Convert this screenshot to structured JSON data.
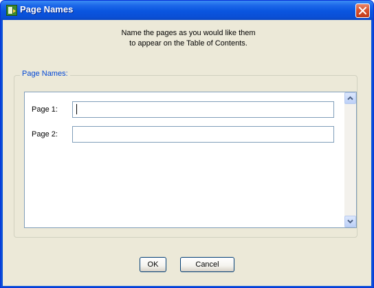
{
  "window": {
    "title": "Page Names",
    "icon": "page-names-app-icon",
    "close_icon": "close-icon"
  },
  "instructions": {
    "line1": "Name the pages as you would like them",
    "line2": "to appear on the Table of Contents."
  },
  "group": {
    "legend": "Page Names:"
  },
  "pages": [
    {
      "label": "Page 1:",
      "value": "",
      "focused": true
    },
    {
      "label": "Page 2:",
      "value": "",
      "focused": false
    }
  ],
  "scrollbar": {
    "up_icon": "chevron-up-icon",
    "down_icon": "chevron-down-icon"
  },
  "buttons": {
    "ok_label": "OK",
    "cancel_label": "Cancel"
  },
  "colors": {
    "title_bar": "#0a55df",
    "close_button": "#d8532f",
    "dialog_background": "#ece9d8",
    "group_legend_text": "#0046d5",
    "field_border": "#7f9db9"
  }
}
